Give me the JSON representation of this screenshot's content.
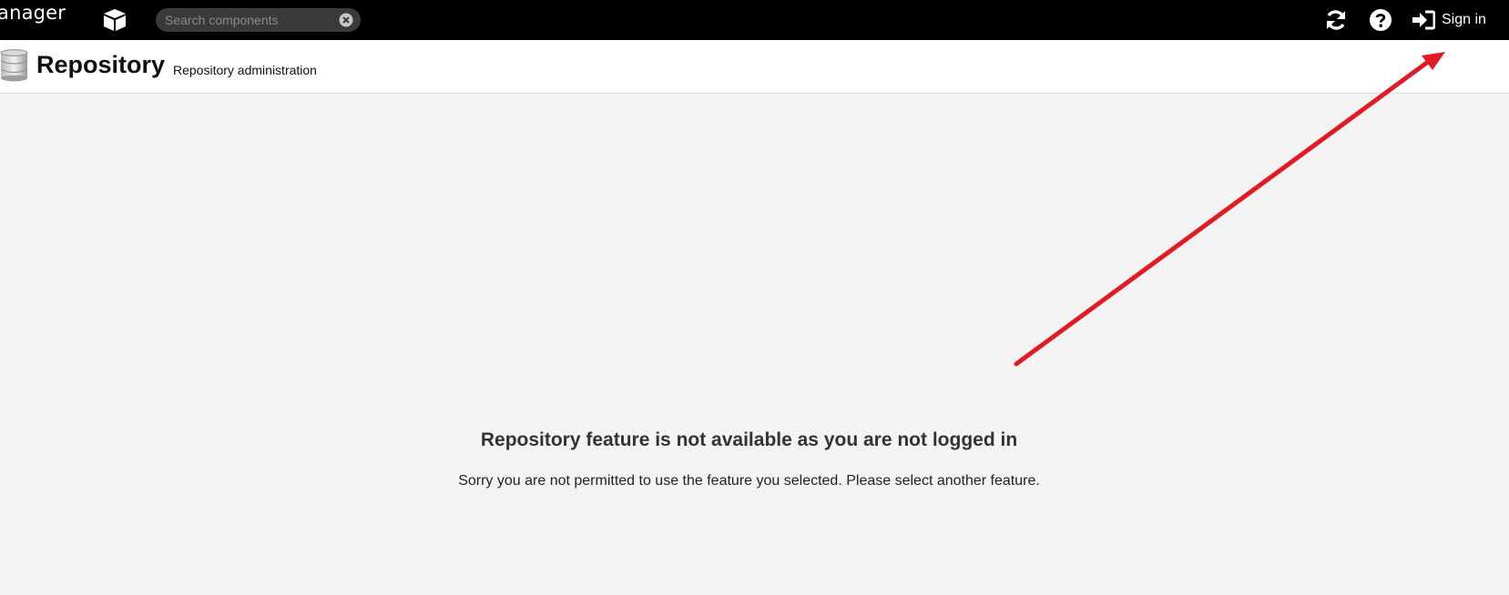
{
  "topbar": {
    "app_name": "anager",
    "cube_icon": "cube-icon",
    "search": {
      "placeholder": "Search components",
      "value": ""
    },
    "clear_icon": "clear-circle-icon",
    "refresh_icon": "refresh-icon",
    "help_icon": "help-circle-icon",
    "signin_icon": "sign-in-icon",
    "signin_label": "Sign in"
  },
  "header": {
    "icon": "database-icon",
    "title": "Repository",
    "subtitle": "Repository administration"
  },
  "main": {
    "heading": "Repository feature is not available as you are not logged in",
    "body": "Sorry you are not permitted to use the feature you selected. Please select another feature."
  },
  "annotation": {
    "type": "arrow",
    "color": "#e01b24"
  },
  "colors": {
    "topbar_bg": "#000000",
    "page_bg": "#f3f3f3",
    "header_bg": "#ffffff",
    "search_bg": "#3a3a3a"
  }
}
